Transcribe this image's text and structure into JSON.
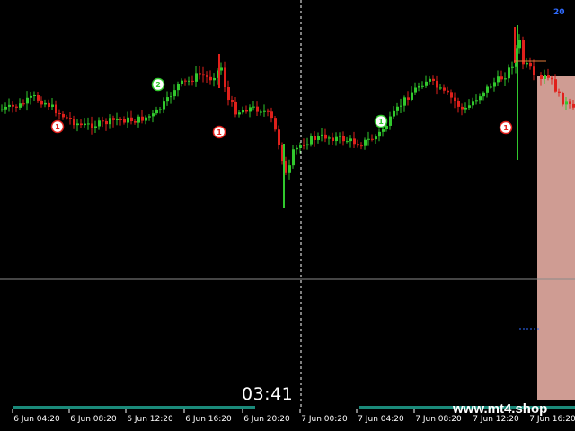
{
  "timer": "03:41",
  "watermark": "www.mt4.shop",
  "corner_indicator": "20",
  "colors": {
    "background": "#000000",
    "bull": "#31c82d",
    "bear": "#e0201b",
    "separator": "#ffffff",
    "hline": "#8a8a8a",
    "zone": "#f3b7ad",
    "bars": "#1a8a7a"
  },
  "chart_data": {
    "type": "candlestick",
    "x_ticks": [
      "6 Jun 04:20",
      "6 Jun 08:20",
      "6 Jun 12:20",
      "6 Jun 16:20",
      "6 Jun 20:20",
      "7 Jun 00:20",
      "7 Jun 04:20",
      "7 Jun 08:20",
      "7 Jun 12:20",
      "7 Jun 16:20"
    ],
    "markers": [
      {
        "label": "1",
        "type": "sell"
      },
      {
        "label": "2",
        "type": "buy"
      },
      {
        "label": "1",
        "type": "sell"
      },
      {
        "label": "1",
        "type": "buy"
      },
      {
        "label": "1",
        "type": "sell"
      }
    ]
  }
}
